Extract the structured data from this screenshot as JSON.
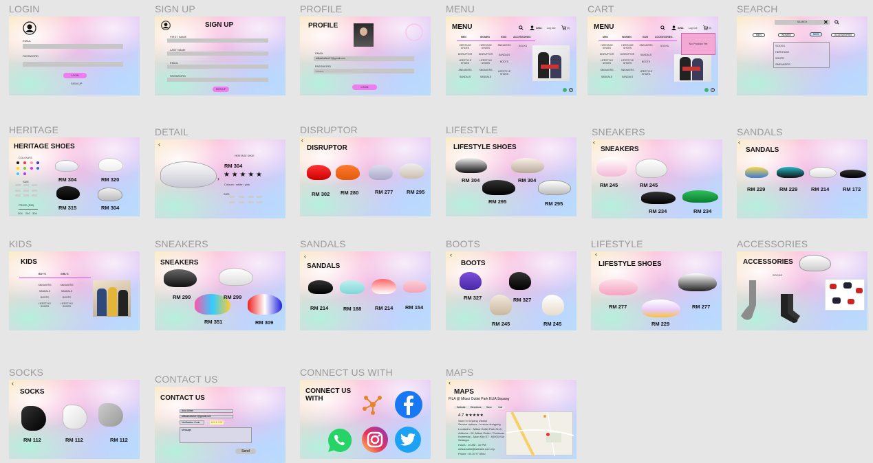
{
  "labels": {
    "login": "LOGIN",
    "signup": "SIGN UP",
    "profile": "PROFILE",
    "menu": "MENU",
    "cart": "CART",
    "search": "SEARCH",
    "heritage": "HERITAGE",
    "detail": "DETAIL",
    "disruptor": "DISRUPTOR",
    "lifestyle": "LIFESTYLE",
    "sneakers": "SNEAKERS",
    "sandals": "SANDALS",
    "kids": "KIDS",
    "sneakers2": "SNEAKERS",
    "sandals2": "SANDALS",
    "boots": "BOOTS",
    "lifestyle2": "LIFESTYLE",
    "accessories": "ACCESSORIES",
    "socks": "SOCKS",
    "contact": "CONTACT US",
    "connect": "CONNECT US WITH",
    "maps": "MAPS"
  },
  "login": {
    "email": "EMAIL",
    "password": "PASSWORD",
    "button": "LOGIN",
    "signup": "SIGN UP"
  },
  "signup": {
    "title": "SIGN UP",
    "first": "FIRST NAME",
    "last": "LAST NAME",
    "email": "EMAIL",
    "password": "PASSWORD",
    "button": "SIGN UP"
  },
  "profile": {
    "title": "PROFILE",
    "email_label": "EMAIL",
    "email": "alifiaahaifani17@gmail.com",
    "password_label": "PASSWORD",
    "password": "••••••••",
    "button": "LOGIN"
  },
  "menu": {
    "title": "MENU",
    "user": "AINA",
    "logout": "Log Out",
    "cart": "(0)",
    "men": "MEN",
    "women": "WOMEN",
    "kids": "KIDS",
    "accessories": "ACCESSORIES",
    "men_items": [
      "HERITAGE SHOES",
      "DISRUPTOR",
      "LIFESTYLE SHOES",
      "SNEAKERS",
      "SANDALS"
    ],
    "women_items": [
      "HERITAGE SHOES",
      "DISRUPTOR",
      "LIFESTYLE SHOES",
      "SNEAKERS",
      "SANDALS"
    ],
    "kids_items": [
      "SNEAKERS",
      "SANDALS",
      "BOOTS",
      "LIFESTYLE SHOES"
    ],
    "acc_items": [
      "SOCKS"
    ]
  },
  "cart": {
    "empty": "No Product Yet"
  },
  "search": {
    "placeholder": "SEARCH",
    "tabs": [
      "MEN",
      "WOMEN",
      "KIDS",
      "ACCESSORIES"
    ],
    "results": [
      "SOCKS",
      "HERITAGE",
      "WHITE",
      "SNEAKERS"
    ]
  },
  "heritage": {
    "title": "HERITAGE SHOES",
    "colours": "COLOURS",
    "size": "SIZE",
    "price": "PRICE (RM)",
    "prices": [
      "RM 304",
      "RM 320",
      "RM 315",
      "RM 304"
    ],
    "price_vals": [
      "204",
      "240",
      "304"
    ]
  },
  "detail": {
    "name": "HERITAGE SHOE",
    "price": "RM 304",
    "stars": "★ ★ ★ ★ ★",
    "colours": "Colours : white / pink",
    "size": "SIZE"
  },
  "disruptor": {
    "title": "DISRUPTOR",
    "prices": [
      "RM 302",
      "RM 280",
      "RM 277",
      "RM 295"
    ]
  },
  "lifestyle": {
    "title": "LIFESTYLE SHOES",
    "prices": [
      "RM 304",
      "RM 304",
      "RM 295",
      "RM 295"
    ]
  },
  "sneakers": {
    "title": "SNEAKERS",
    "prices": [
      "RM 245",
      "RM 245",
      "RM 234",
      "RM 234"
    ]
  },
  "sandals": {
    "title": "SANDALS",
    "prices": [
      "RM 229",
      "RM 229",
      "RM 214",
      "RM 172"
    ]
  },
  "kids": {
    "title": "KIDS",
    "boys": "BOY'S",
    "girls": "GIRL'S",
    "boys_items": [
      "SNEAKERS",
      "SANDALS",
      "BOOTS",
      "LIFESTYLE SHOES"
    ],
    "girls_items": [
      "SNEAKERS",
      "SANDALS",
      "BOOTS",
      "LIFESTYLE SHOES"
    ]
  },
  "sneakers2": {
    "title": "SNEAKERS",
    "prices": [
      "RM 299",
      "RM 299",
      "RM 351",
      "RM 309"
    ]
  },
  "sandals2": {
    "title": "SANDALS",
    "prices": [
      "RM 214",
      "RM 188",
      "RM 214",
      "RM 154"
    ]
  },
  "boots": {
    "title": "BOOTS",
    "prices": [
      "RM 327",
      "RM 327",
      "RM 245",
      "RM 245"
    ]
  },
  "lifestyle2": {
    "title": "LIFESTYLE SHOES",
    "prices": [
      "RM 277",
      "RM 277",
      "RM 229"
    ]
  },
  "accessories": {
    "title": "ACCESSORIES",
    "socks": "SOCKS"
  },
  "socks": {
    "title": "SOCKS",
    "prices": [
      "RM 112",
      "RM 112",
      "RM 112"
    ]
  },
  "contact": {
    "title": "CONTACT US",
    "name": "Aina Afifah",
    "email": "alifiaahaifani17@gmail.com",
    "code_label": "Verification Code",
    "code": "A 5 1 3 D",
    "message": "Message",
    "send": "Send"
  },
  "connect": {
    "title": "CONNECT US WITH"
  },
  "maps": {
    "title": "MAPS",
    "place": "FILA @ Mitsui Outlet Park KLIA Sepang",
    "buttons": [
      "Website",
      "Directions",
      "Save",
      "Call"
    ],
    "rating": "4.7 ★★★★★",
    "info": [
      "Store in Sepang District",
      "Service options : In-store shopping",
      "Located in : Mitsui Outlet Park KLIA",
      "Address : 26, Mitsui Outlet , Persiaran",
      "Komersial , Jalan Klia S7 , 64000 Klia",
      "Selangor",
      "Hours : 10 AM - 10 PM",
      "mitsuioutlet@website.com.my",
      "Phone : 03-5777 5000"
    ]
  },
  "colors": {
    "pink_btn": "#ee7df0",
    "nav_line": "#c94fd8",
    "facebook": "#1877f2",
    "whatsapp": "#25d366",
    "twitter": "#1da1f2",
    "connect_orange": "#e2862a"
  }
}
